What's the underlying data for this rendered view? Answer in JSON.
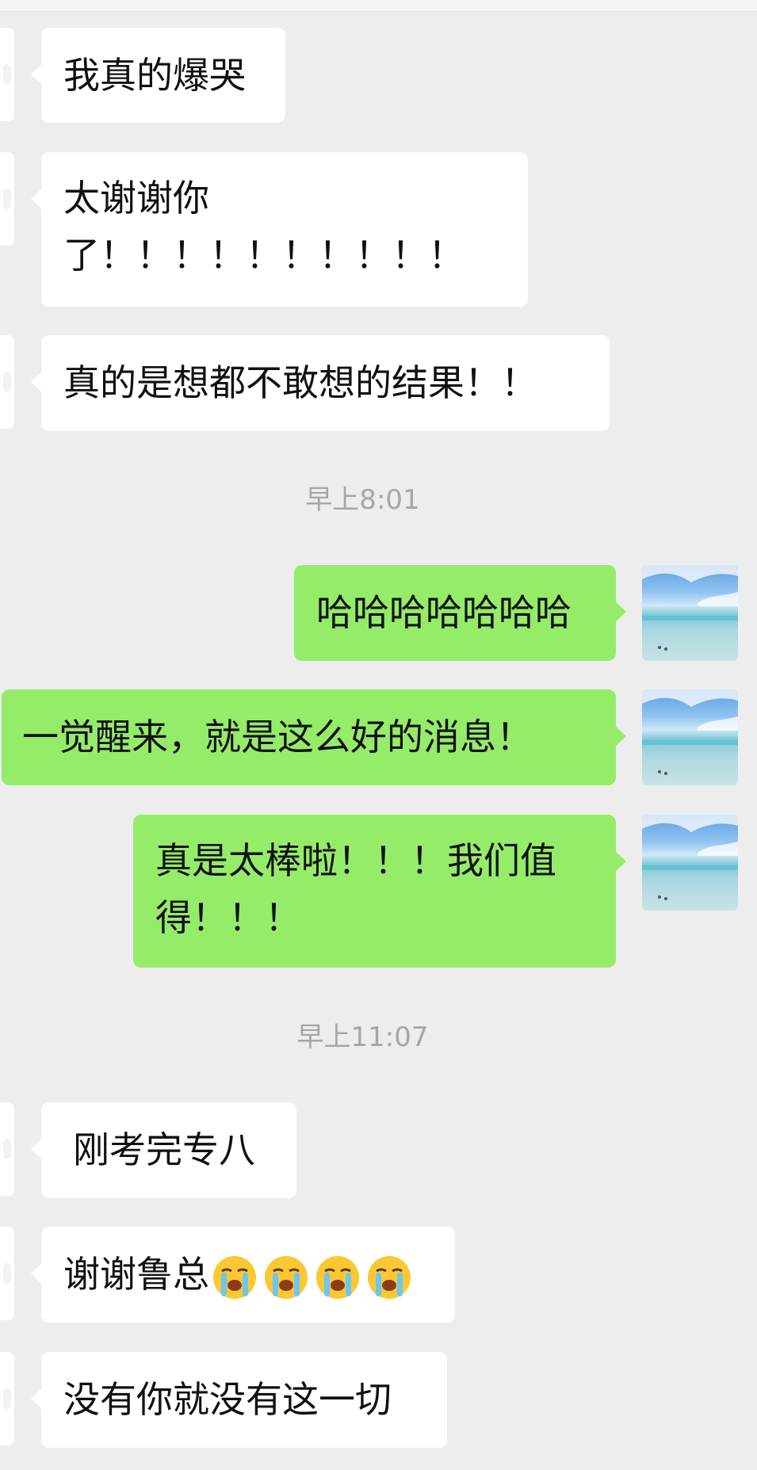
{
  "messages": [
    {
      "side": "in",
      "text": "我真的爆哭"
    },
    {
      "side": "in",
      "lines": [
        "太谢谢你",
        "了！！！！！！！！！！"
      ]
    },
    {
      "side": "in",
      "text": "真的是想都不敢想的结果！！"
    },
    {
      "timestamp": "早上8:01"
    },
    {
      "side": "out",
      "text": "哈哈哈哈哈哈哈"
    },
    {
      "side": "out",
      "text": "一觉醒来，就是这么好的消息！"
    },
    {
      "side": "out",
      "lines": [
        "真是太棒啦！！！我们值",
        "得！！！"
      ]
    },
    {
      "timestamp": "早上11:07"
    },
    {
      "side": "in",
      "text": "刚考完专八"
    },
    {
      "side": "in",
      "text": "谢谢鲁总",
      "emoji": [
        "loudly-crying-face",
        "loudly-crying-face",
        "loudly-crying-face",
        "loudly-crying-face"
      ]
    },
    {
      "side": "in",
      "text": "没有你就没有这一切"
    }
  ],
  "colors": {
    "background": "#ededed",
    "incoming_bubble": "#ffffff",
    "outgoing_bubble": "#95ec69",
    "timestamp_text": "#a6a6a6"
  }
}
